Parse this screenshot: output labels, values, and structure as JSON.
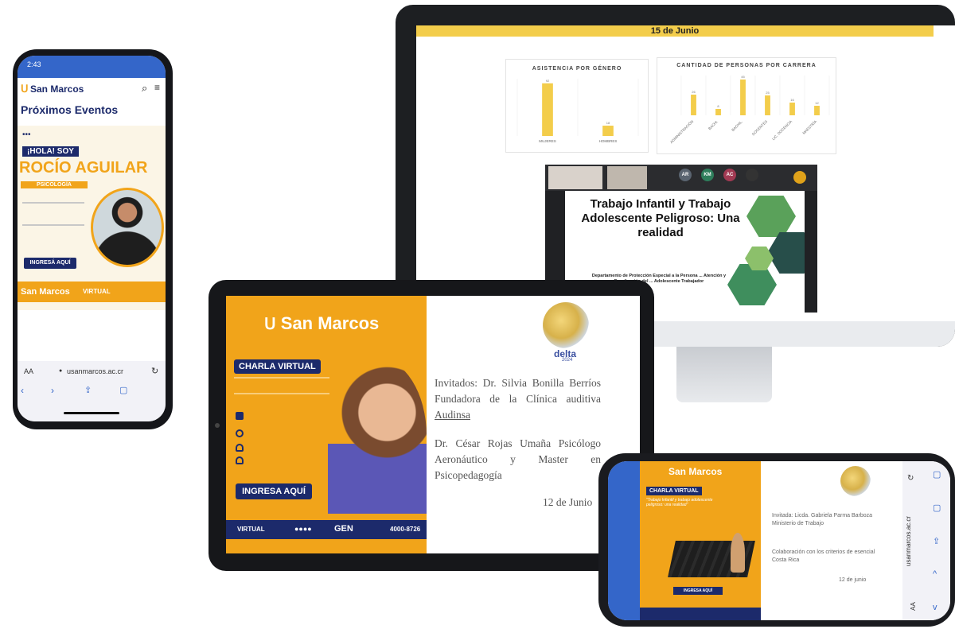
{
  "monitor": {
    "date": "15 de Junio",
    "chart1": {
      "title": "ASISTENCIA POR GÉNERO"
    },
    "chart2": {
      "title": "CANTIDAD DE PERSONAS POR CARRERA"
    },
    "zoom": {
      "participants": [
        "AR",
        "KM",
        "AC"
      ],
      "slide_title": "Trabajo Infantil y Trabajo Adolescente Peligroso: Una realidad",
      "slide_sub": "Departamento de Protección Especial a la Persona ... Atención y Erradicación del ... Adolescente Trabajador"
    },
    "colors": {
      "accent": "#f3cd4b",
      "frame": "#1d1f22"
    }
  },
  "chart_data": [
    {
      "type": "bar",
      "title": "ASISTENCIA POR GÉNERO",
      "categories": [
        "MUJERES",
        "HOMBRES"
      ],
      "values": [
        92,
        18
      ],
      "ylim": [
        0,
        100
      ]
    },
    {
      "type": "bar",
      "title": "CANTIDAD DE PERSONAS POR CARRERA",
      "categories": [
        "ADMINISTRACIÓN",
        "BACHI.",
        "BACHIL.",
        "DOCENTES",
        "LIC. DOCENCIA",
        "MAESTRÍA"
      ],
      "values": [
        26,
        8,
        45,
        25,
        16,
        12
      ],
      "ylim": [
        0,
        50
      ]
    }
  ],
  "tablet": {
    "brand": "San Marcos",
    "badge": "CHARLA VIRTUAL",
    "cta": "INGRESA AQUÍ",
    "phone_number": "4000-8726",
    "footer_virtual": "VIRTUAL",
    "footer_gen": "GEN",
    "logo_word": "delta",
    "logo_year": "2024",
    "invitados_p1_prefix": "Invitados: Dr. Silvia Bonilla Berríos Fundadora de la Clínica auditiva ",
    "invitados_p1_link": "Audinsa",
    "invitados_p2": "Dr. César Rojas Umaña Psicólogo Aeronáutico y Master en Psicopedagogía",
    "date": "12 de Junio"
  },
  "phone": {
    "time": "2:43",
    "brand": "San Marcos",
    "section_title": "Próximos Eventos",
    "hola": "¡HOLA! SOY",
    "name": "ROCÍO AGUILAR",
    "tag": "PSICOLOGÍA",
    "cta": "INGRESÁ AQUÍ",
    "footer_brand": "San Marcos",
    "footer_virtual": "VIRTUAL",
    "aa_label": "AA",
    "url": "usanmarcos.ac.cr"
  },
  "phone2": {
    "brand": "San Marcos",
    "badge": "CHARLA VIRTUAL",
    "subtitle": "\"Trabajo Infantil y trabajo adolescente peligroso: una realidad\"",
    "cta": "INGRESA AQUÍ",
    "invitada": "Invitada: Licda. Gabriela Parma Barboza Ministerio de Trabajo",
    "colab": "Colaboración con los criterios de esencial Costa Rica",
    "date": "12 de junio",
    "url": "usanmarcos.ac.cr",
    "aa_label": "AA"
  }
}
